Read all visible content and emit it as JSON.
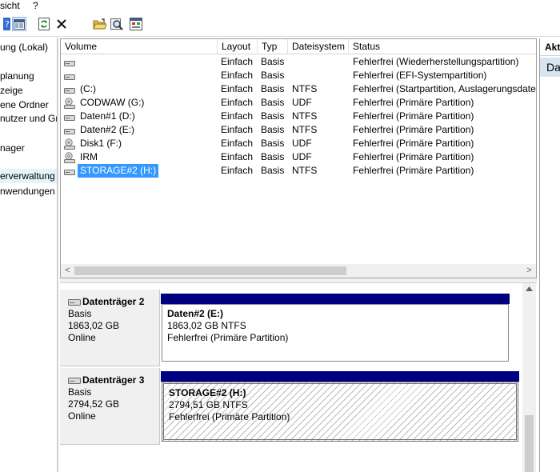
{
  "menu": {
    "items": [
      "sicht",
      "?"
    ]
  },
  "toolbar": {
    "icons": [
      "help-icon",
      "show-hide-pane-icon",
      "refresh-icon",
      "delete-icon",
      "open-folder-icon",
      "search-icon",
      "properties-icon"
    ]
  },
  "tree": {
    "items": [
      {
        "label": "ung (Lokal)"
      },
      {
        "label": "planung"
      },
      {
        "label": "zeige"
      },
      {
        "label": "ene Ordner"
      },
      {
        "label": "nutzer und Gr"
      },
      {
        "label": "nager"
      },
      {
        "label": "erverwaltung"
      },
      {
        "label": "nwendungen"
      }
    ]
  },
  "volumes": {
    "columns": [
      "Volume",
      "Layout",
      "Typ",
      "Dateisystem",
      "Status"
    ],
    "rows": [
      {
        "name": "",
        "layout": "Einfach",
        "type": "Basis",
        "fs": "",
        "status": "Fehlerfrei (Wiederherstellungspartition)",
        "icon": "drive-icon"
      },
      {
        "name": "",
        "layout": "Einfach",
        "type": "Basis",
        "fs": "",
        "status": "Fehlerfrei (EFI-Systempartition)",
        "icon": "drive-icon"
      },
      {
        "name": "(C:)",
        "layout": "Einfach",
        "type": "Basis",
        "fs": "NTFS",
        "status": "Fehlerfrei (Startpartition, Auslagerungsdatei",
        "icon": "drive-icon"
      },
      {
        "name": "CODWAW (G:)",
        "layout": "Einfach",
        "type": "Basis",
        "fs": "UDF",
        "status": "Fehlerfrei (Primäre Partition)",
        "icon": "cd-drive-icon"
      },
      {
        "name": "Daten#1 (D:)",
        "layout": "Einfach",
        "type": "Basis",
        "fs": "NTFS",
        "status": "Fehlerfrei (Primäre Partition)",
        "icon": "drive-icon"
      },
      {
        "name": "Daten#2 (E:)",
        "layout": "Einfach",
        "type": "Basis",
        "fs": "NTFS",
        "status": "Fehlerfrei (Primäre Partition)",
        "icon": "drive-icon"
      },
      {
        "name": "Disk1 (F:)",
        "layout": "Einfach",
        "type": "Basis",
        "fs": "UDF",
        "status": "Fehlerfrei (Primäre Partition)",
        "icon": "cd-drive-icon"
      },
      {
        "name": "IRM",
        "layout": "Einfach",
        "type": "Basis",
        "fs": "UDF",
        "status": "Fehlerfrei (Primäre Partition)",
        "icon": "cd-drive-icon"
      },
      {
        "name": "STORAGE#2 (H:)",
        "layout": "Einfach",
        "type": "Basis",
        "fs": "NTFS",
        "status": "Fehlerfrei (Primäre Partition)",
        "icon": "drive-icon",
        "selected": true
      }
    ],
    "scroll_left": "<",
    "scroll_right": ">"
  },
  "disks": [
    {
      "name": "Datenträger 2",
      "kind": "Basis",
      "size": "1863,02 GB",
      "state": "Online",
      "partition": {
        "name": "Daten#2  (E:)",
        "detail": "1863,02 GB NTFS",
        "status": "Fehlerfrei (Primäre Partition)",
        "hatched": false
      }
    },
    {
      "name": "Datenträger 3",
      "kind": "Basis",
      "size": "2794,52 GB",
      "state": "Online",
      "partition": {
        "name": "STORAGE#2  (H:)",
        "detail": "2794,51 GB NTFS",
        "status": "Fehlerfrei (Primäre Partition)",
        "hatched": true
      }
    }
  ],
  "actions": {
    "header": "Akti",
    "item": "Da"
  },
  "colors": {
    "partition_bar": "#000080",
    "selection": "#3399ff",
    "action_item_bg": "#d9e4f1"
  }
}
